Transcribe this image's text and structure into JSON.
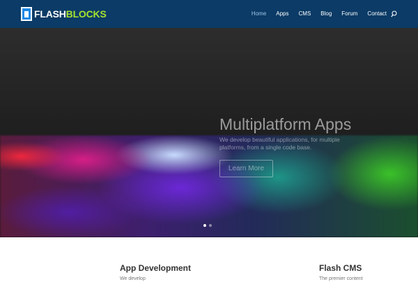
{
  "brand": {
    "name_part1": "FLASH",
    "name_part2": "BLOCKS",
    "primary_color": "#0b3b66",
    "accent_color": "#a6e22e",
    "logo_icon": "tablet-icon"
  },
  "nav": {
    "items": [
      {
        "label": "Home",
        "active": true
      },
      {
        "label": "Apps",
        "active": false
      },
      {
        "label": "CMS",
        "active": false
      },
      {
        "label": "Blog",
        "active": false
      },
      {
        "label": "Forum",
        "active": false
      },
      {
        "label": "Contact",
        "active": false
      }
    ],
    "search_icon": "search-icon"
  },
  "hero": {
    "title": "Multiplatform Apps",
    "subtitle": "We develop beautiful applications, for  multiple platforms, from a single code base.",
    "button_label": "Learn More",
    "slides": 2,
    "active_slide": 1
  },
  "features": [
    {
      "title": "App Development",
      "text": "We develop"
    },
    {
      "title": "Flash CMS",
      "text": "The premier content"
    }
  ]
}
